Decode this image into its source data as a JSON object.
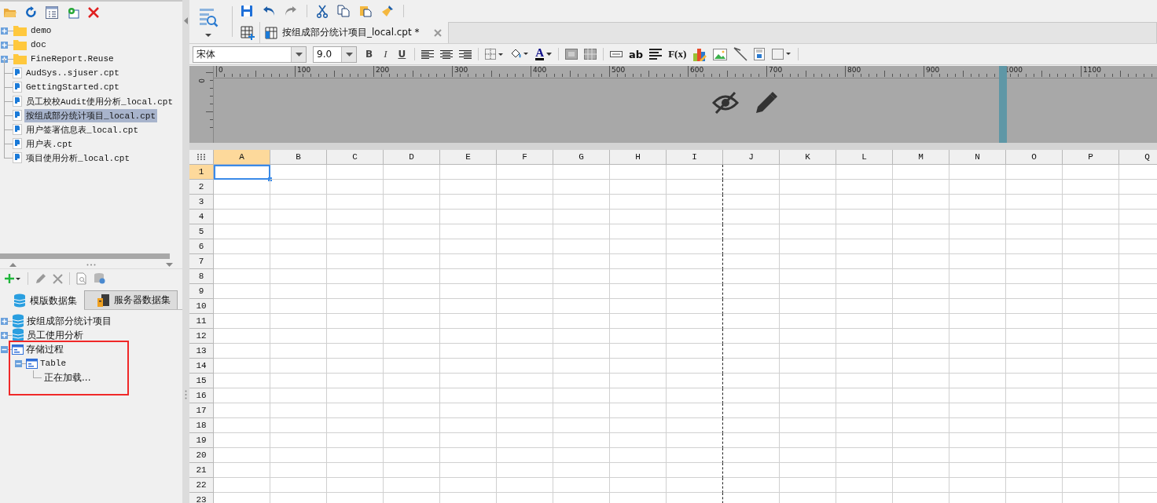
{
  "file_tree": [
    {
      "label": "demo",
      "kind": "folder",
      "expanded": false,
      "selected": false
    },
    {
      "label": "doc",
      "kind": "folder",
      "expanded": false,
      "selected": false
    },
    {
      "label": "FineReport.Reuse",
      "kind": "folder",
      "expanded": false,
      "selected": false
    },
    {
      "label": "AudSys..sjuser.cpt",
      "kind": "file",
      "selected": false
    },
    {
      "label": "GettingStarted.cpt",
      "kind": "file",
      "selected": false
    },
    {
      "label": "员工校校Audit使用分析_local.cpt",
      "kind": "file",
      "selected": false
    },
    {
      "label": "按组成部分统计项目_local.cpt",
      "kind": "file",
      "selected": true
    },
    {
      "label": "用户签署信息表_local.cpt",
      "kind": "file",
      "selected": false
    },
    {
      "label": "用户表.cpt",
      "kind": "file",
      "selected": false
    },
    {
      "label": "项目使用分析_local.cpt",
      "kind": "file",
      "selected": false
    }
  ],
  "dataset_tabs": [
    {
      "label": "模版数据集",
      "kind": "template",
      "selected": true
    },
    {
      "label": "服务器数据集",
      "kind": "server",
      "selected": false
    }
  ],
  "dataset_tree": [
    {
      "label": "按组成部分统计项目",
      "kind": "dataset",
      "expanded": false,
      "highlighted": false
    },
    {
      "label": "员工使用分析",
      "kind": "dataset",
      "expanded": false,
      "highlighted": false
    },
    {
      "label": "存储过程",
      "kind": "procedure",
      "expanded": true,
      "highlighted": true,
      "children": [
        {
          "label": "Table",
          "kind": "table",
          "expanded": true,
          "children": [
            {
              "label": "正在加载...",
              "kind": "loading"
            }
          ]
        }
      ]
    }
  ],
  "document_tab": {
    "title": "按组成部分统计项目_local.cpt *",
    "selected": true
  },
  "format_toolbar": {
    "font": "宋体",
    "size": "9.0",
    "bold": "B",
    "italic": "I",
    "underline": "U",
    "font_color": "A",
    "text_label": "ab",
    "formula": "F(x)"
  },
  "ruler": {
    "labels": [
      "0",
      "100",
      "200",
      "300",
      "400",
      "500",
      "600",
      "700",
      "800",
      "900",
      "1000",
      "1100"
    ],
    "vertical_label": "0"
  },
  "sheet": {
    "columns": [
      {
        "label": "A",
        "selected": true,
        "page_break": false
      },
      {
        "label": "B",
        "selected": false,
        "page_break": false
      },
      {
        "label": "C",
        "selected": false,
        "page_break": false
      },
      {
        "label": "D",
        "selected": false,
        "page_break": false
      },
      {
        "label": "E",
        "selected": false,
        "page_break": false
      },
      {
        "label": "F",
        "selected": false,
        "page_break": false
      },
      {
        "label": "G",
        "selected": false,
        "page_break": false
      },
      {
        "label": "H",
        "selected": false,
        "page_break": false
      },
      {
        "label": "I",
        "selected": false,
        "page_break": true
      },
      {
        "label": "J",
        "selected": false,
        "page_break": false
      },
      {
        "label": "K",
        "selected": false,
        "page_break": false
      },
      {
        "label": "L",
        "selected": false,
        "page_break": false
      },
      {
        "label": "M",
        "selected": false,
        "page_break": false
      },
      {
        "label": "N",
        "selected": false,
        "page_break": false
      },
      {
        "label": "O",
        "selected": false,
        "page_break": false
      },
      {
        "label": "P",
        "selected": false,
        "page_break": false
      },
      {
        "label": "Q",
        "selected": false,
        "page_break": false
      }
    ],
    "rows": [
      {
        "label": "1",
        "selected": true
      },
      {
        "label": "2",
        "selected": false
      },
      {
        "label": "3",
        "selected": false
      },
      {
        "label": "4",
        "selected": false
      },
      {
        "label": "5",
        "selected": false
      },
      {
        "label": "6",
        "selected": false
      },
      {
        "label": "7",
        "selected": false
      },
      {
        "label": "8",
        "selected": false
      },
      {
        "label": "9",
        "selected": false
      },
      {
        "label": "10",
        "selected": false
      },
      {
        "label": "11",
        "selected": false
      },
      {
        "label": "12",
        "selected": false
      },
      {
        "label": "13",
        "selected": false
      },
      {
        "label": "14",
        "selected": false
      },
      {
        "label": "15",
        "selected": false
      },
      {
        "label": "16",
        "selected": false
      },
      {
        "label": "17",
        "selected": false
      },
      {
        "label": "18",
        "selected": false
      },
      {
        "label": "19",
        "selected": false
      },
      {
        "label": "20",
        "selected": false
      },
      {
        "label": "21",
        "selected": false
      },
      {
        "label": "22",
        "selected": false
      },
      {
        "label": "23",
        "selected": false
      }
    ]
  }
}
